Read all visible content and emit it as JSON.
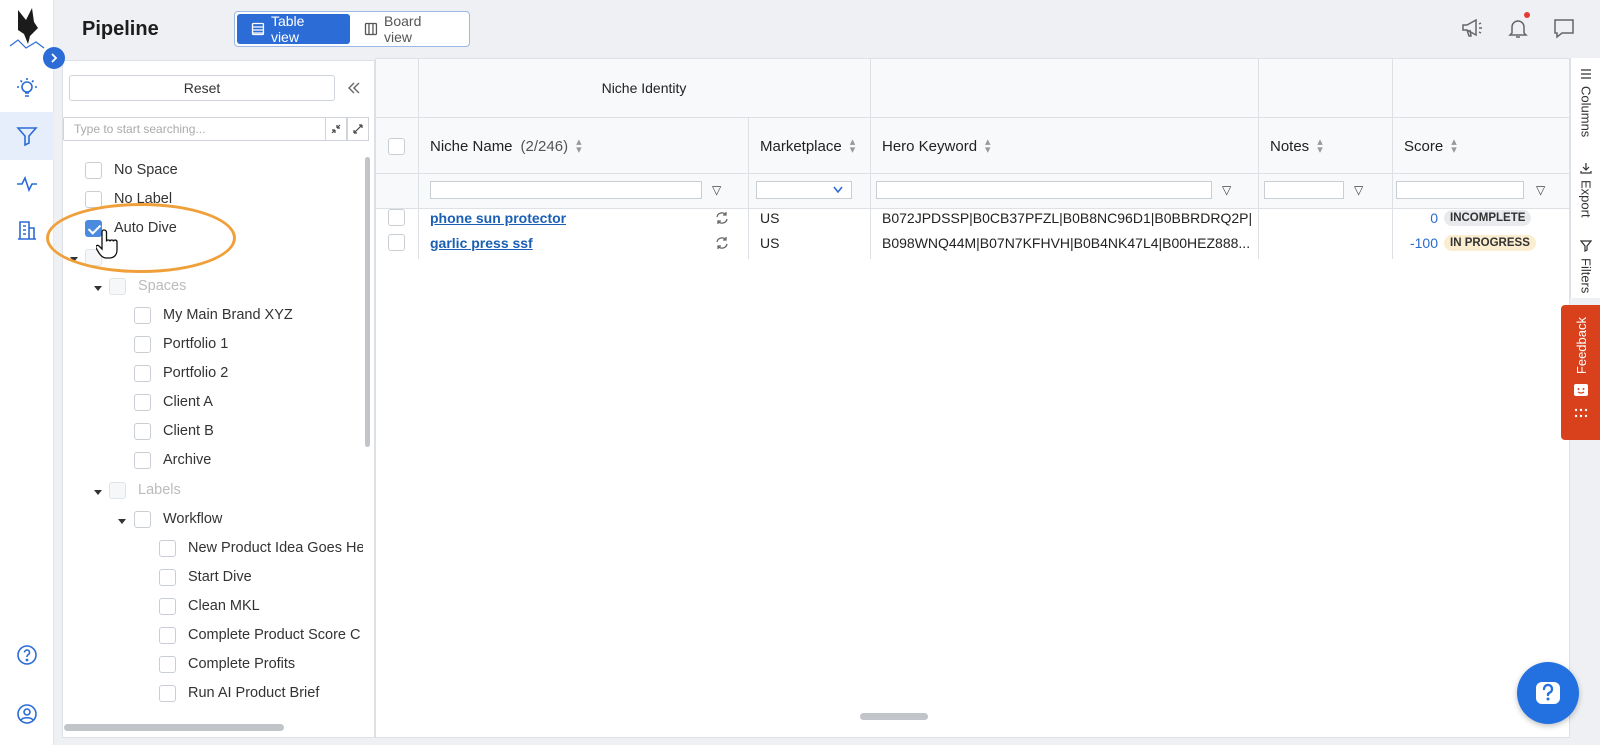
{
  "rail": {
    "expand_icon": "chevron-right-icon",
    "icons": [
      "lightbulb-icon",
      "filter-icon",
      "activity-icon",
      "building-icon",
      "help-icon",
      "user-icon"
    ]
  },
  "header": {
    "title": "Pipeline",
    "views": [
      {
        "label": "Table view",
        "icon": "table-icon",
        "active": true
      },
      {
        "label": "Board view",
        "icon": "board-icon",
        "active": false
      }
    ],
    "icons": [
      "megaphone-icon",
      "bell-icon",
      "chat-icon"
    ]
  },
  "filter_panel": {
    "reset_label": "Reset",
    "search_placeholder": "Type to start searching...",
    "items": [
      {
        "label": "No Space",
        "checked": false
      },
      {
        "label": "No Label",
        "checked": false
      },
      {
        "label": "Auto Dive",
        "checked": true
      },
      {
        "label": "",
        "checked": false
      },
      {
        "label": "Spaces",
        "checked": false,
        "group": true
      },
      {
        "label": "My Main Brand XYZ",
        "checked": false
      },
      {
        "label": "Portfolio 1",
        "checked": false
      },
      {
        "label": "Portfolio 2",
        "checked": false
      },
      {
        "label": "Client A",
        "checked": false
      },
      {
        "label": "Client B",
        "checked": false
      },
      {
        "label": "Archive",
        "checked": false
      },
      {
        "label": "Labels",
        "checked": false,
        "group": true
      },
      {
        "label": "Workflow",
        "checked": false
      },
      {
        "label": "New Product Idea Goes He",
        "checked": false
      },
      {
        "label": "Start Dive",
        "checked": false
      },
      {
        "label": "Clean MKL",
        "checked": false
      },
      {
        "label": "Complete Product Score C",
        "checked": false
      },
      {
        "label": "Complete Profits",
        "checked": false
      },
      {
        "label": "Run AI Product Brief",
        "checked": false
      }
    ]
  },
  "grid": {
    "group_header": "Niche Identity",
    "columns": {
      "niche_name": "Niche Name",
      "niche_count": "(2/246)",
      "marketplace": "Marketplace",
      "hero_keyword": "Hero Keyword",
      "notes": "Notes",
      "score": "Score"
    },
    "rows": [
      {
        "niche": "phone sun protector",
        "marketplace": "US",
        "hero_keyword": "B072JPDSSP|B0CB37PFZL|B0B8NC96D1|B0BBRDRQ2P|...",
        "notes": "",
        "score": "0",
        "status": "INCOMPLETE"
      },
      {
        "niche": "garlic press ssf",
        "marketplace": "US",
        "hero_keyword": "B098WNQ44M|B07N7KFHVH|B0B4NK47L4|B00HEZ888...",
        "notes": "",
        "score": "-100",
        "status": "IN PROGRESS"
      }
    ]
  },
  "side_tabs": {
    "columns": "Columns",
    "export": "Export",
    "filters": "Filters"
  },
  "feedback_label": "Feedback",
  "colors": {
    "accent": "#2c6cd6",
    "link": "#1a5fb4",
    "feedback": "#d9401c",
    "highlight": "#f0a03a"
  }
}
